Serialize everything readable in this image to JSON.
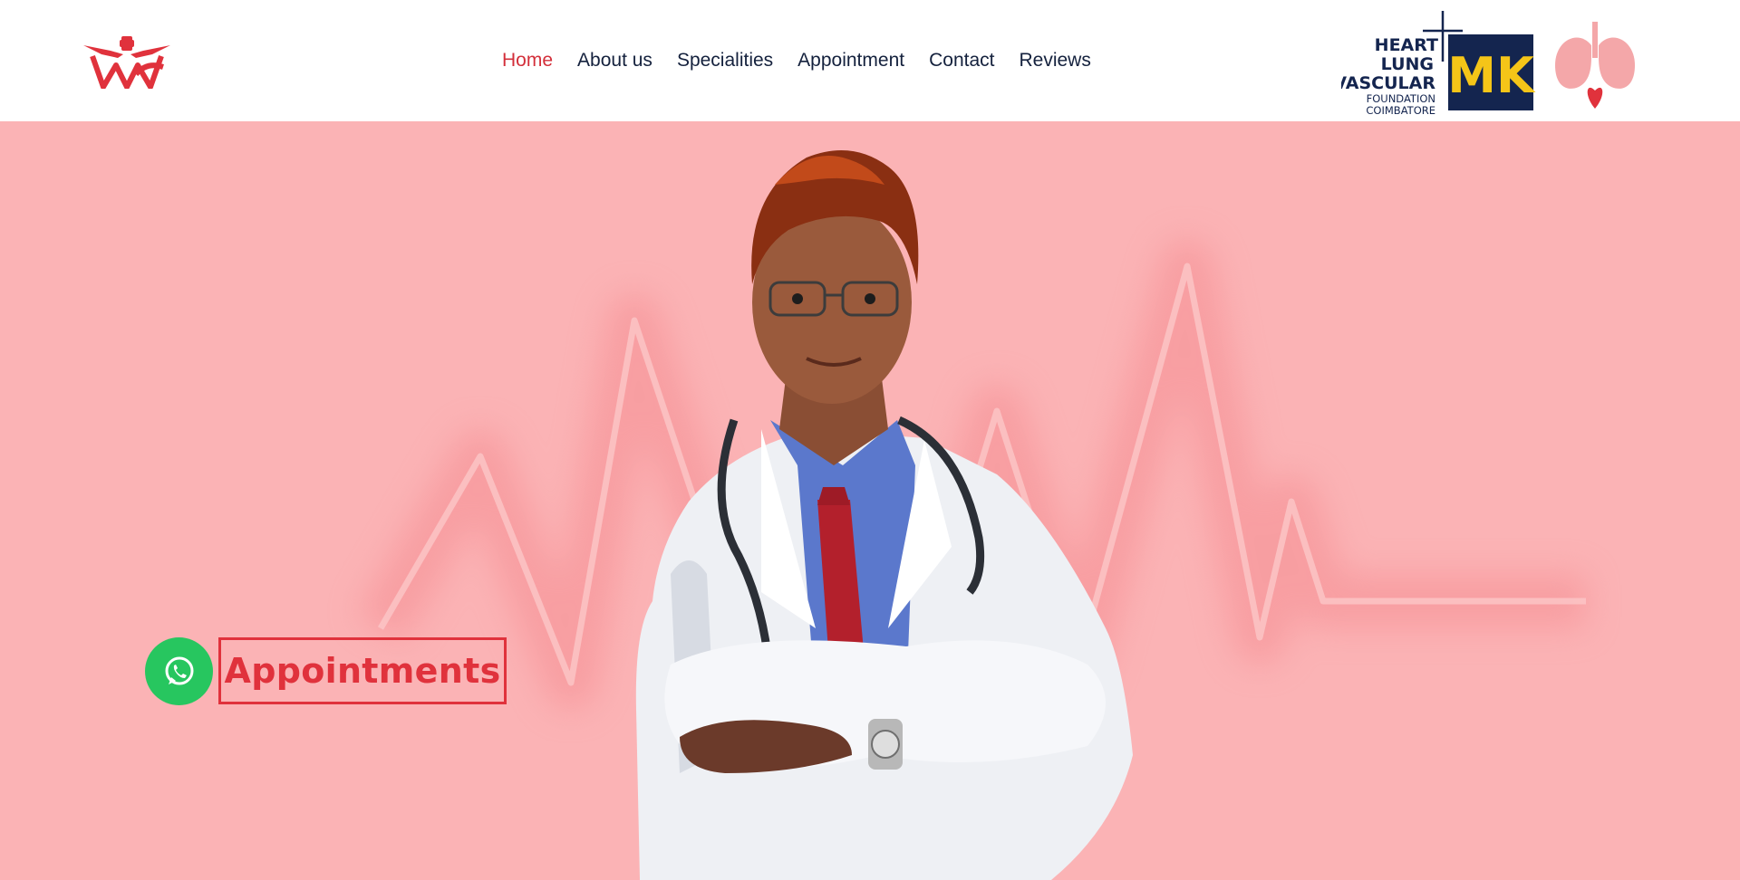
{
  "header": {
    "logo_left_icon": "winged-heart-logo-icon",
    "nav": [
      {
        "label": "Home",
        "active": true
      },
      {
        "label": "About us",
        "active": false
      },
      {
        "label": "Specialities",
        "active": false
      },
      {
        "label": "Appointment",
        "active": false
      },
      {
        "label": "Contact",
        "active": false
      },
      {
        "label": "Reviews",
        "active": false
      }
    ],
    "foundation_logo": {
      "lines": [
        "HEART",
        "LUNG",
        "VASCULAR",
        "FOUNDATION",
        "COIMBATORE"
      ],
      "badge": "MK"
    },
    "lungs_icon": "lungs-heart-icon"
  },
  "hero": {
    "whatsapp_icon": "whatsapp-icon",
    "appointments_label": "Appointments",
    "doctor_photo": "doctor-portrait"
  },
  "colors": {
    "accent_red": "#e0323c",
    "nav_text": "#14213d",
    "hero_bg": "#fbb3b5",
    "whatsapp_green": "#27c65f",
    "foundation_navy": "#14254f",
    "badge_yellow": "#f5c518"
  }
}
